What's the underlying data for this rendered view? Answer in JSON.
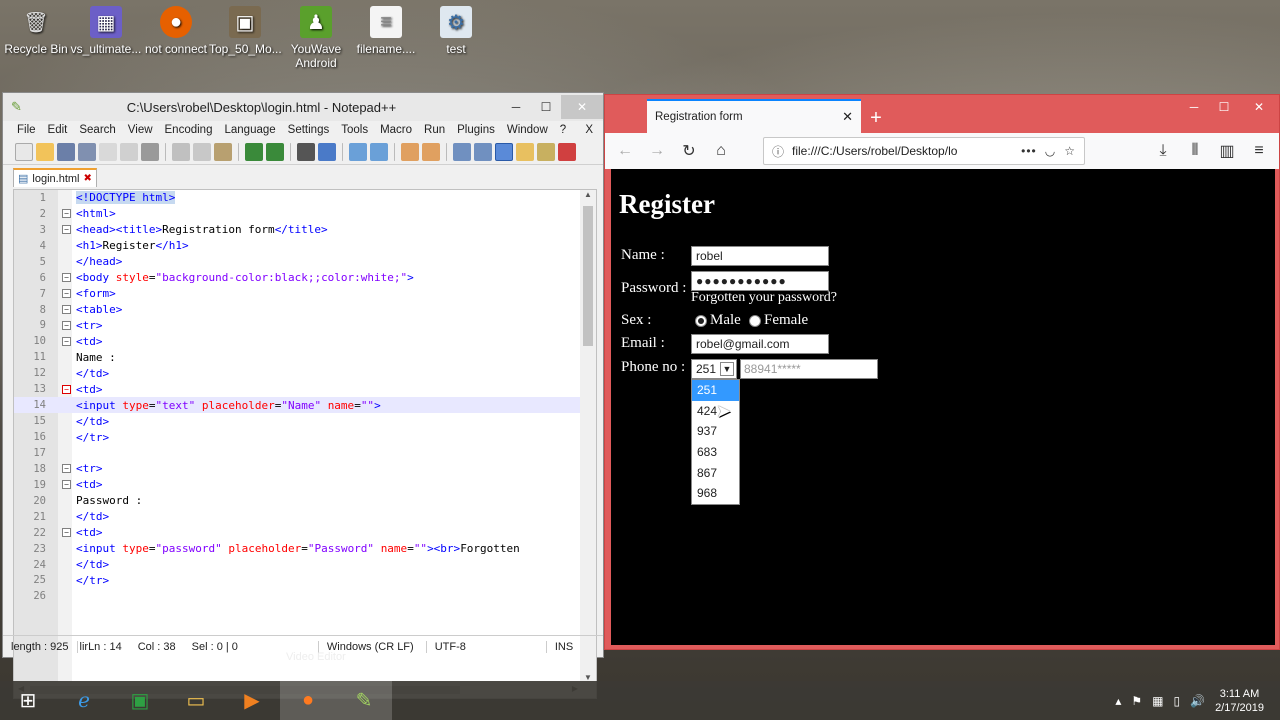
{
  "desktop": {
    "icons": [
      {
        "label": "Recycle Bin",
        "icon": "recycle-bin-icon"
      },
      {
        "label": "vs_ultimate...",
        "icon": "installer-icon"
      },
      {
        "label": "not connect",
        "icon": "firefox-icon"
      },
      {
        "label": "Top_50_Mo...",
        "icon": "image-file-icon"
      },
      {
        "label": "YouWave Android",
        "icon": "android-icon"
      },
      {
        "label": "filename....",
        "icon": "document-icon"
      },
      {
        "label": "test",
        "icon": "shortcut-icon"
      }
    ]
  },
  "notepad": {
    "title": "C:\\Users\\robel\\Desktop\\login.html - Notepad++",
    "menu": [
      "File",
      "Edit",
      "Search",
      "View",
      "Encoding",
      "Language",
      "Settings",
      "Tools",
      "Macro",
      "Run",
      "Plugins",
      "Window",
      "?"
    ],
    "menu_close": "X",
    "tab": "login.html",
    "status": {
      "length": "length : 925",
      "lines": "lir",
      "ln": "Ln : 14",
      "col": "Col : 38",
      "sel": "Sel : 0 | 0",
      "eol": "Windows (CR LF)",
      "encoding": "UTF-8",
      "mode": "INS"
    }
  },
  "firefox": {
    "tab_title": "Registration form",
    "url": "file:///C:/Users/robel/Desktop/lo",
    "page": {
      "heading": "Register",
      "name_label": "Name :",
      "name_value": "robel",
      "password_label": "Password :",
      "password_value": "●●●●●●●●●●●",
      "forgot": "Forgotten your password?",
      "sex_label": "Sex :",
      "male": "Male",
      "female": "Female",
      "email_label": "Email :",
      "email_value": "robel@gmail.com",
      "phone_label": "Phone no :",
      "phone_code": "251",
      "phone_placeholder": "88941*****",
      "code_options": [
        "251",
        "424",
        "937",
        "683",
        "867",
        "968"
      ]
    }
  },
  "taskbar": {
    "caption": "Video Editor",
    "time": "3:11 AM",
    "date": "2/17/2019"
  }
}
